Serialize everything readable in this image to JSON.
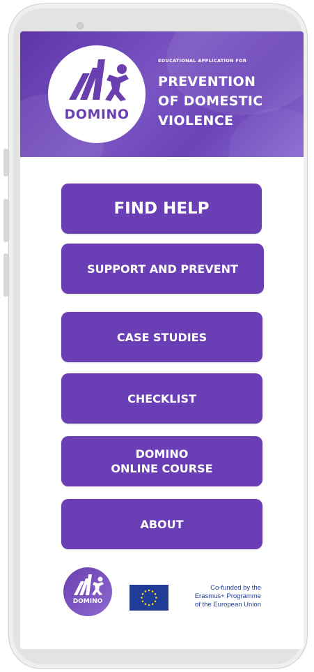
{
  "header": {
    "logo_text": "DOMINO",
    "small_caption": "EDUCATIONAL APPLICATION FOR",
    "title_lines": [
      "PREVENTION",
      "OF DOMESTIC",
      "VIOLENCE"
    ]
  },
  "menu": {
    "find_help": "FIND HELP",
    "support_prevent": "SUPPORT AND PREVENT",
    "case_studies": "CASE STUDIES",
    "checklist": "CHECKLIST",
    "online_course_line1": "DOMINO",
    "online_course_line2": "ONLINE COURSE",
    "about": "ABOUT"
  },
  "footer": {
    "logo_text": "DOMINO",
    "eu_text": [
      "Co-funded by the",
      "Erasmus+ Programme",
      "of the European Union"
    ]
  },
  "colors": {
    "brand_purple": "#6a3fb6",
    "eu_blue": "#1f3d96",
    "eu_star_yellow": "#ffd617"
  }
}
